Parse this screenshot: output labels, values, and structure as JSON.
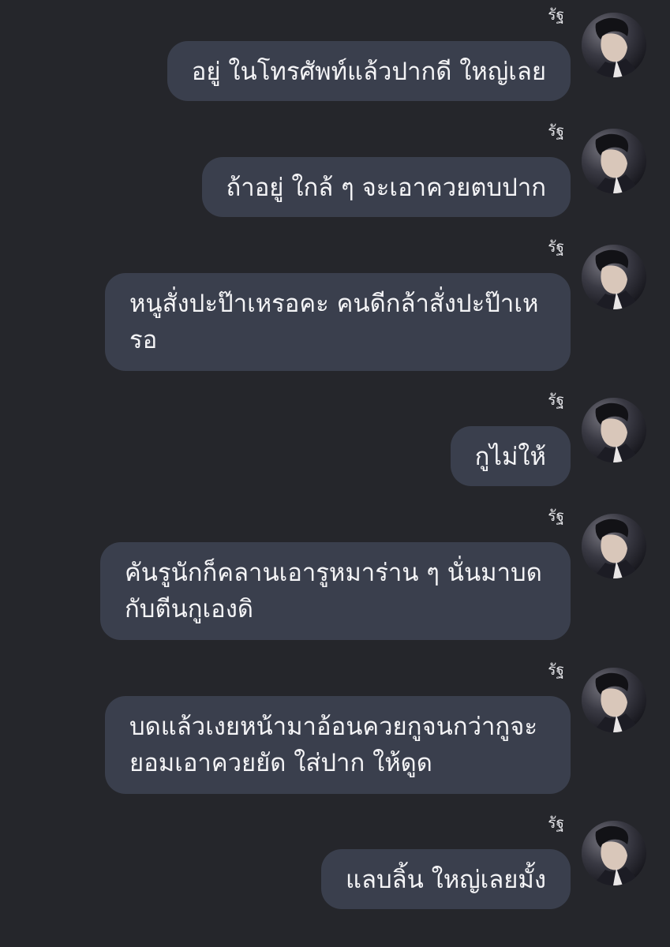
{
  "conversation": {
    "messages": [
      {
        "sender": "รัฐ",
        "text": "อยู่ ในโทรศัพท์แล้วปากดี ใหญ่เลย"
      },
      {
        "sender": "รัฐ",
        "text": "ถ้าอยู่ ใกล้ ๆ จะเอาควยตบปาก"
      },
      {
        "sender": "รัฐ",
        "text": "หนูสั่งปะป๊าเหรอคะ คนดีกล้าสั่งปะป๊าเหรอ"
      },
      {
        "sender": "รัฐ",
        "text": "กูไม่ให้"
      },
      {
        "sender": "รัฐ",
        "text": "คันรูนักก็คลานเอารูหมาร่าน ๆ นั่นมาบดกับตีนกูเองดิ"
      },
      {
        "sender": "รัฐ",
        "text": "บดแล้วเงยหน้ามาอ้อนควยกูจนกว่ากูจะยอมเอาควยยัด ใส่ปาก ให้ดูด"
      },
      {
        "sender": "รัฐ",
        "text": "แลบลิ้น ใหญ่เลยมั้ง"
      }
    ]
  }
}
